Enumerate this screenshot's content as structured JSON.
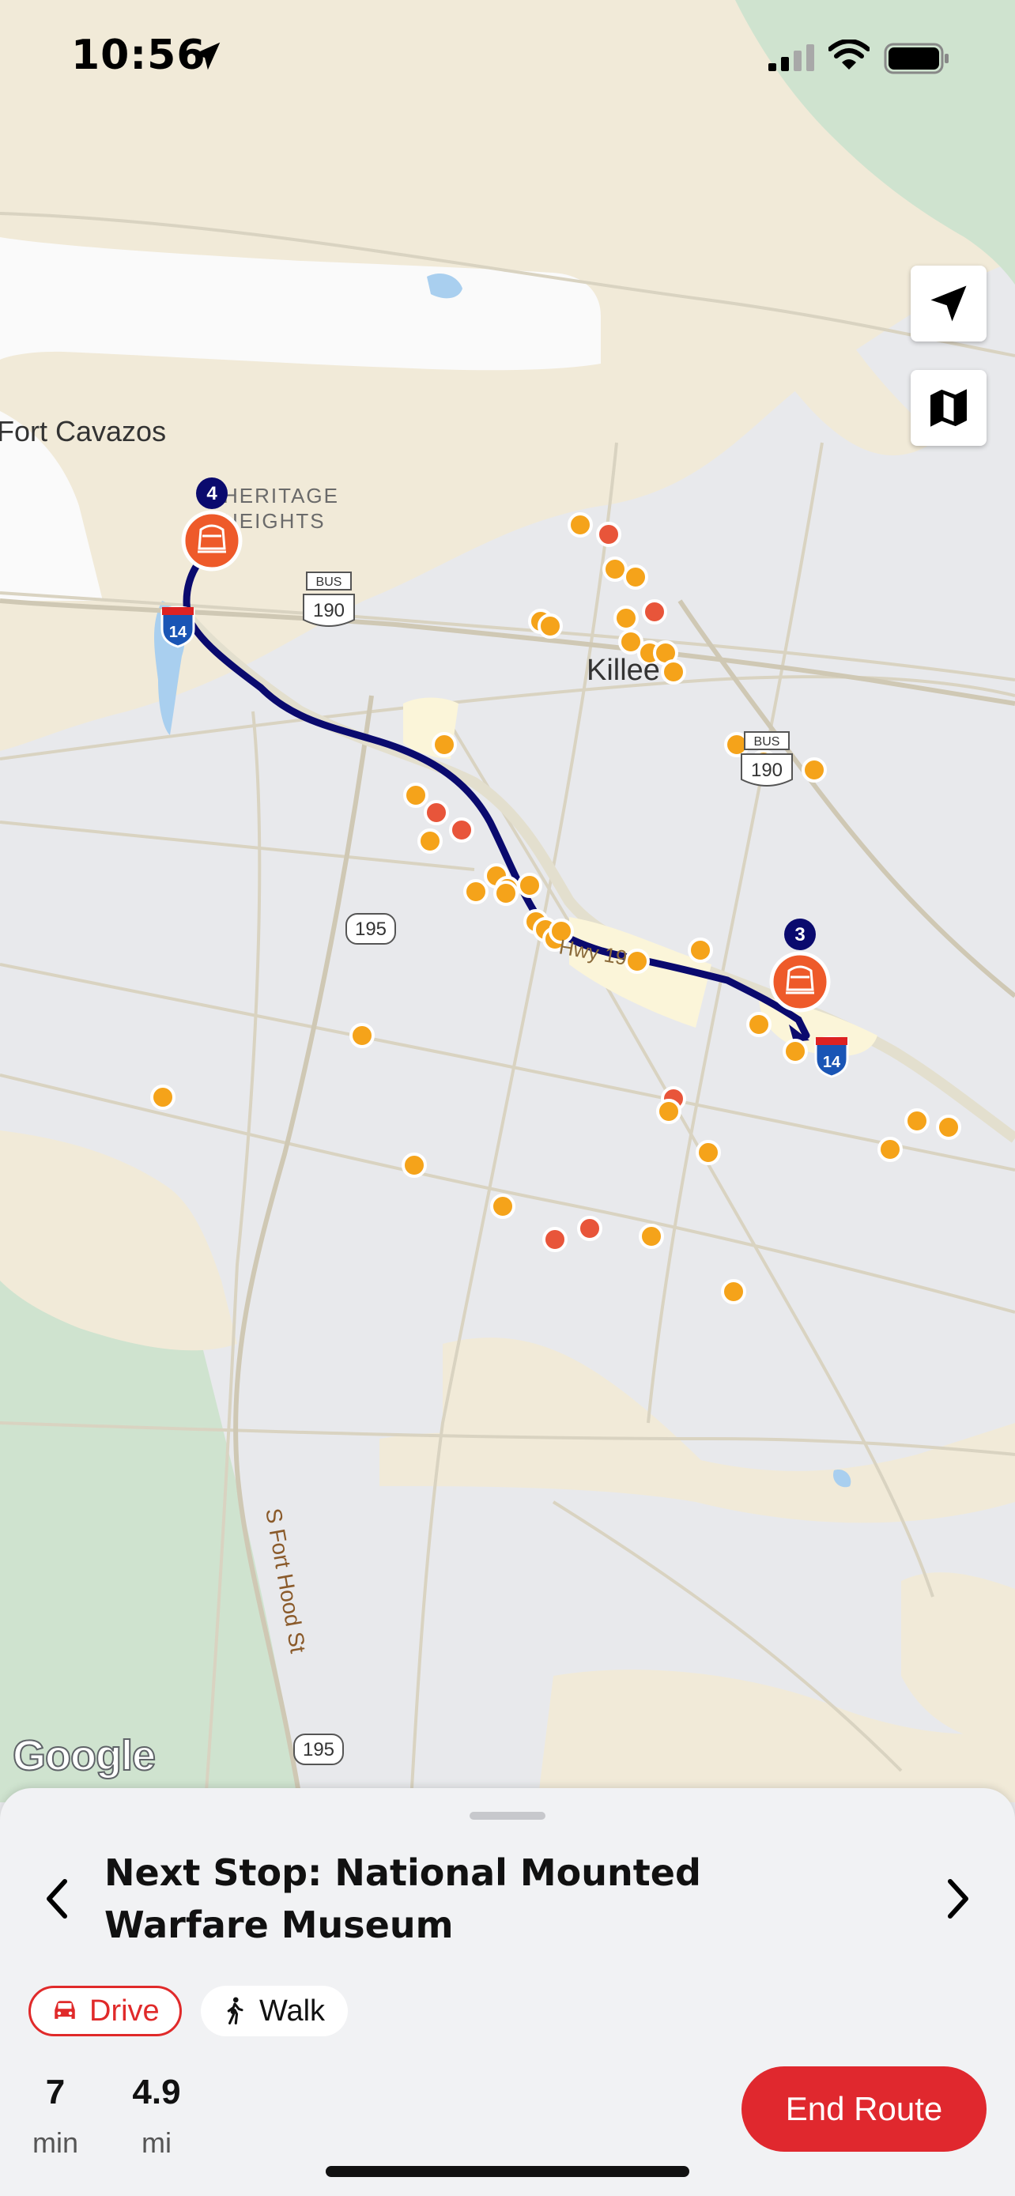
{
  "status_bar": {
    "time": "10:56",
    "icons": [
      "location-arrow-icon",
      "cellular-signal-icon",
      "wifi-icon",
      "battery-icon"
    ]
  },
  "map": {
    "labels": {
      "fort_cavazos": "Fort Cavazos",
      "heritage_1": "HERITAGE",
      "heritage_2": "HEIGHTS",
      "killeen": "Killee",
      "hwy": "Hwy 19",
      "fort_hood_st": "S Fort Hood St"
    },
    "shields": {
      "bus190_a_top": "BUS",
      "bus190_a_num": "190",
      "bus190_b_top": "BUS",
      "bus190_b_num": "190",
      "r195_a": "195",
      "r195_b": "195",
      "i14_a": "14",
      "i14_b": "14"
    },
    "stops": [
      {
        "number": "4",
        "icon": "train-icon"
      },
      {
        "number": "3",
        "icon": "train-icon"
      }
    ],
    "controls": {
      "recenter_icon": "navigation-arrow-icon",
      "map_type_icon": "map-icon"
    },
    "attribution": "Google",
    "colors": {
      "route": "#0a0a6e",
      "pin": "#ee5a2a",
      "poi_orange": "#f5a31a",
      "poi_red": "#e8553a"
    }
  },
  "sheet": {
    "title": "Next Stop: National Mounted Warfare Museum",
    "prev_icon": "chevron-left-icon",
    "next_icon": "chevron-right-icon",
    "modes": {
      "drive": "Drive",
      "walk": "Walk",
      "selected": "Drive"
    },
    "stats": {
      "time_value": "7",
      "time_unit": "min",
      "distance_value": "4.9",
      "distance_unit": "mi"
    },
    "end_button": "End Route",
    "accent": "#e0282e"
  }
}
